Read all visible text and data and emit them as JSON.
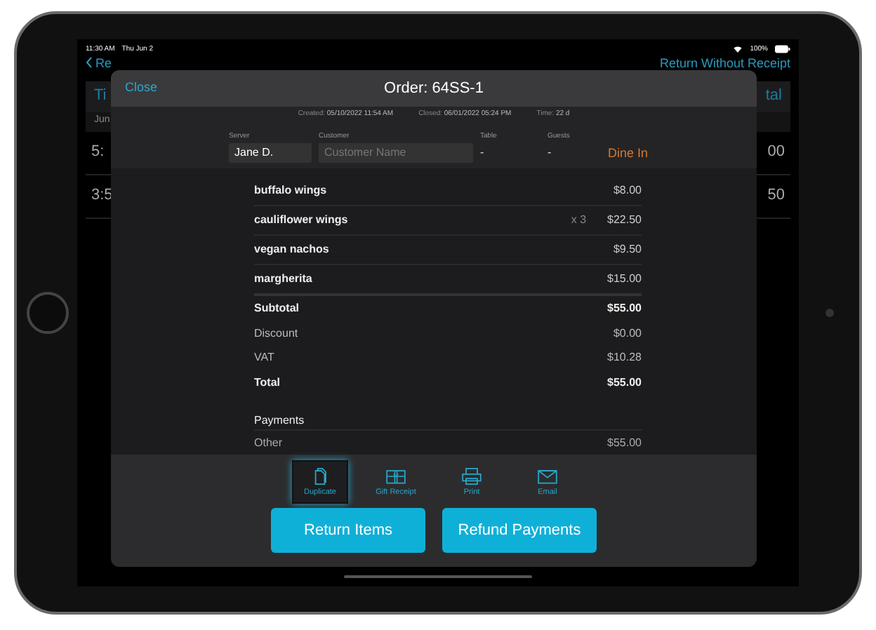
{
  "status_bar": {
    "time": "11:30 AM",
    "date": "Thu Jun 2",
    "battery": "100%"
  },
  "background": {
    "back_label": "Re",
    "action": "Return Without Receipt",
    "columns": [
      "Ti",
      "tal"
    ],
    "section": "Jun",
    "rows": [
      {
        "time": "5:",
        "total": "00"
      },
      {
        "time": "3:5",
        "total": "50"
      }
    ]
  },
  "modal": {
    "close": "Close",
    "title": "Order: 64SS-1",
    "meta": [
      {
        "label": "Created:",
        "value": "05/10/2022 11:54 AM"
      },
      {
        "label": "Closed:",
        "value": "06/01/2022 05:24 PM"
      },
      {
        "label": "Time:",
        "value": "22 d"
      }
    ],
    "server": {
      "label": "Server",
      "value": "Jane D."
    },
    "customer": {
      "label": "Customer",
      "placeholder": "Customer Name"
    },
    "table": {
      "label": "Table",
      "value": "-"
    },
    "guests": {
      "label": "Guests",
      "value": "-"
    },
    "order_type": "Dine In",
    "items": [
      {
        "name": "buffalo wings",
        "price": "$8.00"
      },
      {
        "name": "cauliflower wings",
        "qty": "x 3",
        "price": "$22.50"
      },
      {
        "name": "vegan nachos",
        "price": "$9.50"
      },
      {
        "name": "margherita",
        "price": "$15.00"
      }
    ],
    "totals": [
      {
        "label": "Subtotal",
        "value": "$55.00",
        "kind": "strong"
      },
      {
        "label": "Discount",
        "value": "$0.00",
        "kind": "normal"
      },
      {
        "label": "VAT",
        "value": "$10.28",
        "kind": "normal"
      },
      {
        "label": "Total",
        "value": "$55.00",
        "kind": "strong"
      }
    ],
    "payments_title": "Payments",
    "payments": [
      {
        "label": "Other",
        "value": "$55.00"
      }
    ],
    "actions": [
      {
        "label": "Duplicate",
        "kind": "duplicate",
        "selected": true
      },
      {
        "label": "Gift Receipt",
        "kind": "gift",
        "selected": false
      },
      {
        "label": "Print",
        "kind": "print",
        "selected": false
      },
      {
        "label": "Email",
        "kind": "email",
        "selected": false
      }
    ],
    "buttons": [
      "Return Items",
      "Refund Payments"
    ]
  }
}
